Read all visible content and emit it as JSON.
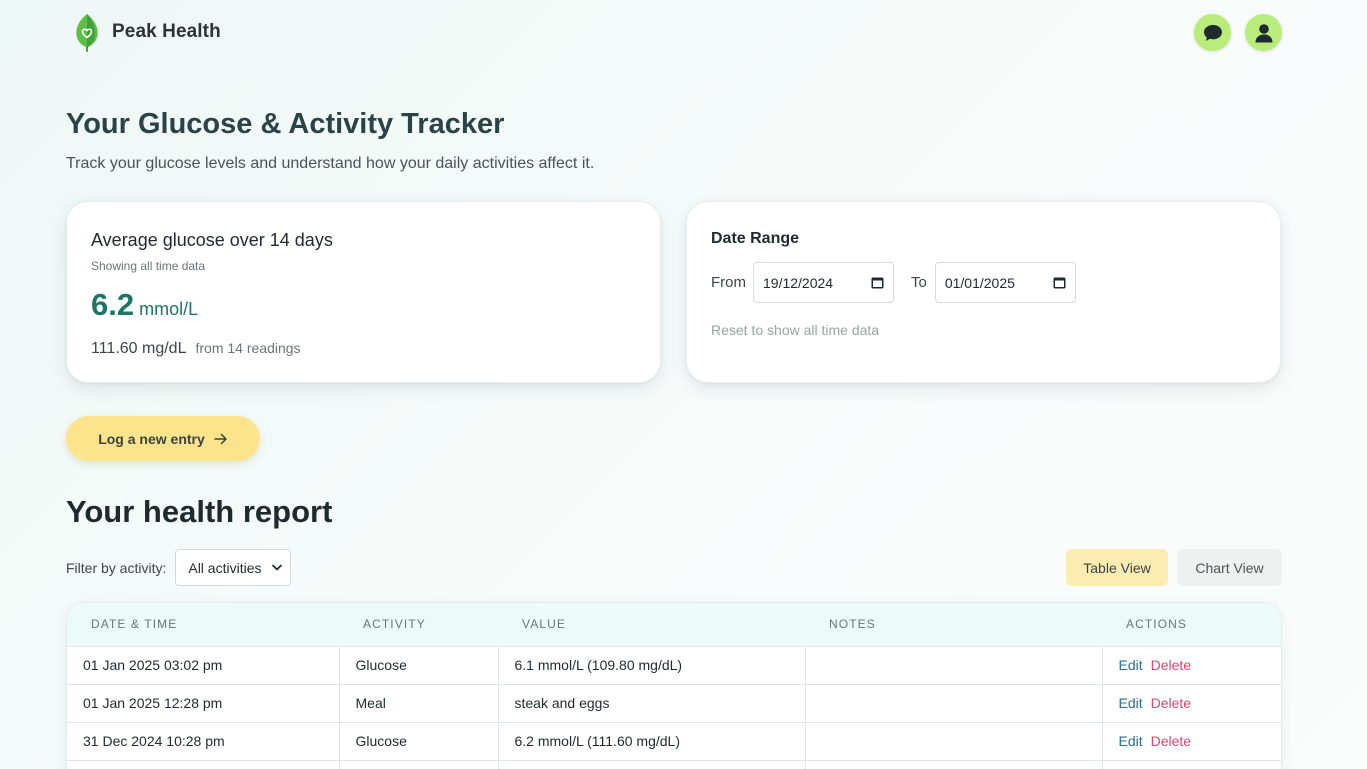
{
  "header": {
    "brand_name": "Peak Health"
  },
  "page": {
    "title": "Your Glucose & Activity Tracker",
    "subtitle": "Track your glucose levels and understand how your daily activities affect it."
  },
  "average_card": {
    "title": "Average glucose over 14 days",
    "subtitle": "Showing all time data",
    "value": "6.2",
    "unit": "mmol/L",
    "mg_value": "111.60 mg/dL",
    "readings_note": "from 14 readings"
  },
  "date_range": {
    "title": "Date Range",
    "from_label": "From",
    "from_value": "19/12/2024",
    "to_label": "To",
    "to_value": "01/01/2025",
    "reset_label": "Reset to show all time data"
  },
  "log_button_label": "Log a new entry",
  "report": {
    "title": "Your health report",
    "filter_label": "Filter by activity:",
    "filter_value": "All activities",
    "table_view_label": "Table View",
    "chart_view_label": "Chart View",
    "columns": [
      "DATE & TIME",
      "ACTIVITY",
      "VALUE",
      "NOTES",
      "ACTIONS"
    ],
    "rows": [
      {
        "datetime": "01 Jan 2025 03:02 pm",
        "activity": "Glucose",
        "value": "6.1 mmol/L (109.80 mg/dL)",
        "notes": "",
        "edit": "Edit",
        "delete": "Delete"
      },
      {
        "datetime": "01 Jan 2025 12:28 pm",
        "activity": "Meal",
        "value": "steak and eggs",
        "notes": "",
        "edit": "Edit",
        "delete": "Delete"
      },
      {
        "datetime": "31 Dec 2024 10:28 pm",
        "activity": "Glucose",
        "value": "6.2 mmol/L (111.60 mg/dL)",
        "notes": "",
        "edit": "Edit",
        "delete": "Delete"
      },
      {
        "datetime": "",
        "activity": "",
        "value": "",
        "notes": "",
        "edit": "",
        "delete": ""
      }
    ]
  },
  "colors": {
    "accent_green": "#1f7566",
    "header_button": "#b9ec7a",
    "log_button": "#fce48c",
    "delete": "#d9486e",
    "edit": "#2c6e8a"
  },
  "icons": {
    "logo": "leaf-heart-icon",
    "chat": "chat-bubble-icon",
    "profile": "user-icon",
    "arrow": "arrow-right-icon",
    "calendar": "calendar-icon",
    "select": "chevron-down-icon"
  }
}
